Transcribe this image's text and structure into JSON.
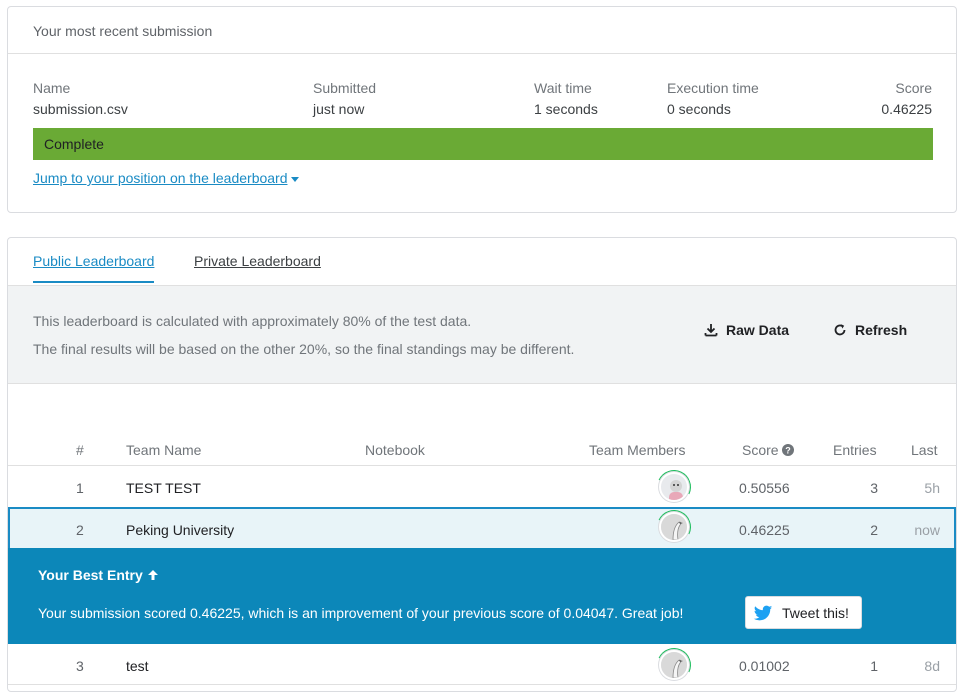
{
  "submission": {
    "header": "Your most recent submission",
    "columns": [
      {
        "label": "Name",
        "value": "submission.csv"
      },
      {
        "label": "Submitted",
        "value": "just now"
      },
      {
        "label": "Wait time",
        "value": "1 seconds"
      },
      {
        "label": "Execution time",
        "value": "0 seconds"
      },
      {
        "label": "Score",
        "value": "0.46225"
      }
    ],
    "status": "Complete",
    "status_color": "#6aaa35",
    "jump_link": "Jump to your position on the leaderboard"
  },
  "leaderboard": {
    "tabs": [
      {
        "label": "Public Leaderboard",
        "active": true
      },
      {
        "label": "Private Leaderboard",
        "active": false
      }
    ],
    "notice_line1": "This leaderboard is calculated with approximately 80% of the test data.",
    "notice_line2": "The final results will be based on the other 20%, so the final standings may be different.",
    "raw_data_label": "Raw Data",
    "refresh_label": "Refresh",
    "headers": {
      "rank": "#",
      "team": "Team Name",
      "notebook": "Notebook",
      "members": "Team Members",
      "score": "Score",
      "entries": "Entries",
      "last": "Last"
    },
    "rows": [
      {
        "rank": "1",
        "team": "TEST TEST",
        "score": "0.50556",
        "entries": "3",
        "last": "5h"
      },
      {
        "rank": "2",
        "team": "Peking University",
        "score": "0.46225",
        "entries": "2",
        "last": "now"
      },
      {
        "rank": "3",
        "team": "test",
        "score": "0.01002",
        "entries": "1",
        "last": "8d"
      }
    ],
    "best_entry": {
      "title": "Your Best Entry",
      "message": "Your submission scored 0.46225, which is an improvement of your previous score of 0.04047. Great job!",
      "tweet_label": "Tweet this!"
    },
    "accent_color": "#1a8bc4",
    "banner_color": "#0c87b9"
  }
}
